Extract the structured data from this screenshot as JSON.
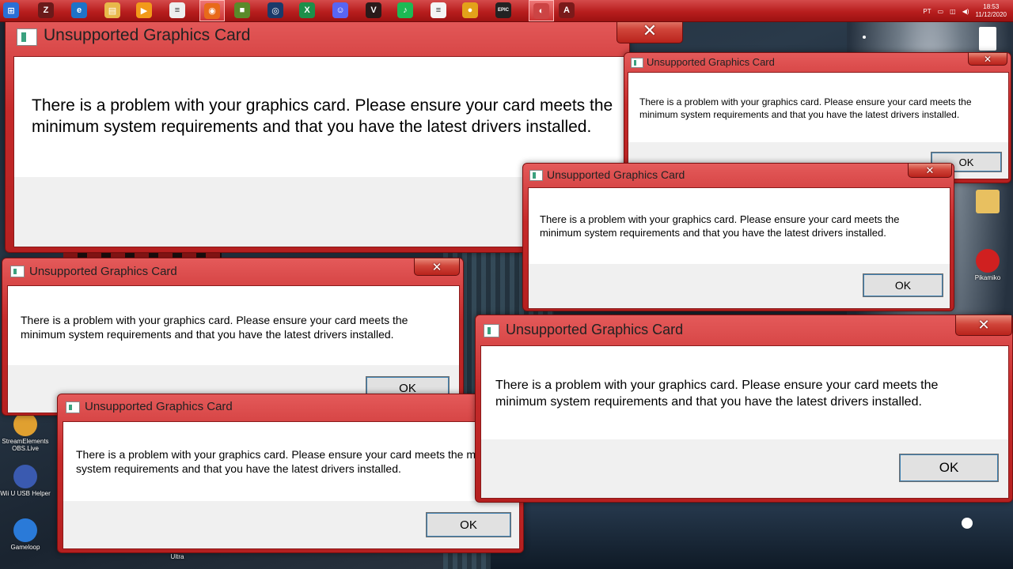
{
  "taskbar": {
    "apps": [
      {
        "name": "start-icon",
        "glyph": "⊞",
        "color": "#2a6fd6"
      },
      {
        "name": "game-app-icon",
        "glyph": "Z",
        "color": "#6a1a1a"
      },
      {
        "name": "ie-icon",
        "glyph": "e",
        "color": "#1e73c8"
      },
      {
        "name": "explorer-icon",
        "glyph": "▤",
        "color": "#e8b84a"
      },
      {
        "name": "media-player-icon",
        "glyph": "▶",
        "color": "#f29a1a"
      },
      {
        "name": "notepad-icon",
        "glyph": "≡",
        "color": "#eeeeee"
      },
      {
        "name": "firefox-icon",
        "glyph": "◉",
        "color": "#e86a1a"
      },
      {
        "name": "minecraft-icon",
        "glyph": "■",
        "color": "#5a8a2a"
      },
      {
        "name": "network-app-icon",
        "glyph": "◎",
        "color": "#1a3a6a"
      },
      {
        "name": "excel-icon",
        "glyph": "X",
        "color": "#1d8f4a"
      },
      {
        "name": "discord-icon",
        "glyph": "☺",
        "color": "#5865f2"
      },
      {
        "name": "valorant-icon",
        "glyph": "V",
        "color": "#2a1a1a"
      },
      {
        "name": "spotify-icon",
        "glyph": "♪",
        "color": "#1db954"
      },
      {
        "name": "document-icon",
        "glyph": "≡",
        "color": "#f4f4f4"
      },
      {
        "name": "chrome-icon",
        "glyph": "●",
        "color": "#e3a21a"
      },
      {
        "name": "epic-games-icon",
        "glyph": "EPIC",
        "color": "#222222"
      },
      {
        "name": "obs-icon",
        "glyph": "◐",
        "color": "#c44"
      },
      {
        "name": "app-a-icon",
        "glyph": "A",
        "color": "#7a1a1a"
      }
    ],
    "tray": {
      "language": "PT",
      "time": "18:53",
      "date": "11/12/2020"
    }
  },
  "desktop_icons": [
    {
      "label": "StreamElements OBS.Live",
      "extra": "G"
    },
    {
      "label": "Wii U USB Helper",
      "extra": "H"
    },
    {
      "label": "Gameloop",
      "extra": ""
    },
    {
      "label": "Ultra",
      "extra": ""
    },
    {
      "label": "Pikamiko",
      "extra": ""
    }
  ],
  "dialogs": [
    {
      "title": "Unsupported Graphics Card",
      "message": "There is a problem with your graphics card. Please ensure your card meets the minimum system requirements and that you have the latest drivers installed.",
      "ok": "OK",
      "close": "✕"
    },
    {
      "title": "Unsupported Graphics Card",
      "message": "There is a problem with your graphics card. Please ensure your card meets the minimum system requirements and that you have the latest drivers installed.",
      "ok": "OK",
      "close": "✕"
    },
    {
      "title": "Unsupported Graphics Card",
      "message": "There is a problem with your graphics card. Please ensure your card meets the minimum system requirements and that you have the latest drivers installed.",
      "ok": "OK",
      "close": "✕"
    },
    {
      "title": "Unsupported Graphics Card",
      "message": "There is a problem with your graphics card. Please ensure your card meets the minimum system requirements and that you have the latest drivers installed.",
      "ok": "OK",
      "close": "✕"
    },
    {
      "title": "Unsupported Graphics Card",
      "message": "There is a problem with your graphics card. Please ensure your card meets the minimum system requirements and that you have the latest drivers installed.",
      "ok": "OK",
      "close": "✕"
    },
    {
      "title": "Unsupported Graphics Card",
      "message": "There is a problem with your graphics card. Please ensure your card meets the minimum system requirements and that you have the latest drivers installed.",
      "ok": "OK",
      "close": "✕"
    }
  ]
}
